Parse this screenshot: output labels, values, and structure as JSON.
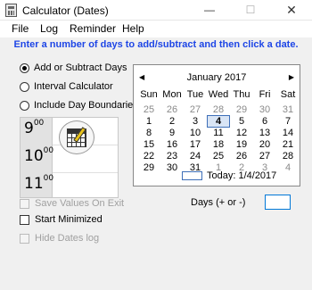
{
  "window": {
    "title": "Calculator (Dates)",
    "minimize": "—",
    "maximize": "☐",
    "close": "✕"
  },
  "menu": {
    "file": "File",
    "log": "Log",
    "reminder": "Reminder",
    "help": "Help"
  },
  "instruction": "Enter a number of days to add/subtract and then click a date.",
  "modes": {
    "add_subtract": "Add or Subtract Days",
    "interval": "Interval Calculator",
    "boundaries": "Include Day Boundaries",
    "selected": "add_subtract"
  },
  "schedule": {
    "hours": [
      "9",
      "10",
      "11"
    ],
    "minutes": "00"
  },
  "options": {
    "save_values": "Save Values On Exit",
    "start_minimized": "Start Minimized",
    "hide_dates": "Hide Dates log"
  },
  "calendar": {
    "prev": "◀",
    "next": "▶",
    "month_title": "January 2017",
    "weekdays": [
      "Sun",
      "Mon",
      "Tue",
      "Wed",
      "Thu",
      "Fri",
      "Sat"
    ],
    "weeks": [
      [
        "25",
        "26",
        "27",
        "28",
        "29",
        "30",
        "31"
      ],
      [
        "1",
        "2",
        "3",
        "4",
        "5",
        "6",
        "7"
      ],
      [
        "8",
        "9",
        "10",
        "11",
        "12",
        "13",
        "14"
      ],
      [
        "15",
        "16",
        "17",
        "18",
        "19",
        "20",
        "21"
      ],
      [
        "22",
        "23",
        "24",
        "25",
        "26",
        "27",
        "28"
      ],
      [
        "29",
        "30",
        "31",
        "1",
        "2",
        "3",
        "4"
      ]
    ],
    "selected_day": "4",
    "today_label": "Today: 1/4/2017"
  },
  "days_field": {
    "label": "Days (+ or -)",
    "value": ""
  },
  "colors": {
    "instruction": "#1e46e6",
    "selection": "#3e6fb8"
  }
}
